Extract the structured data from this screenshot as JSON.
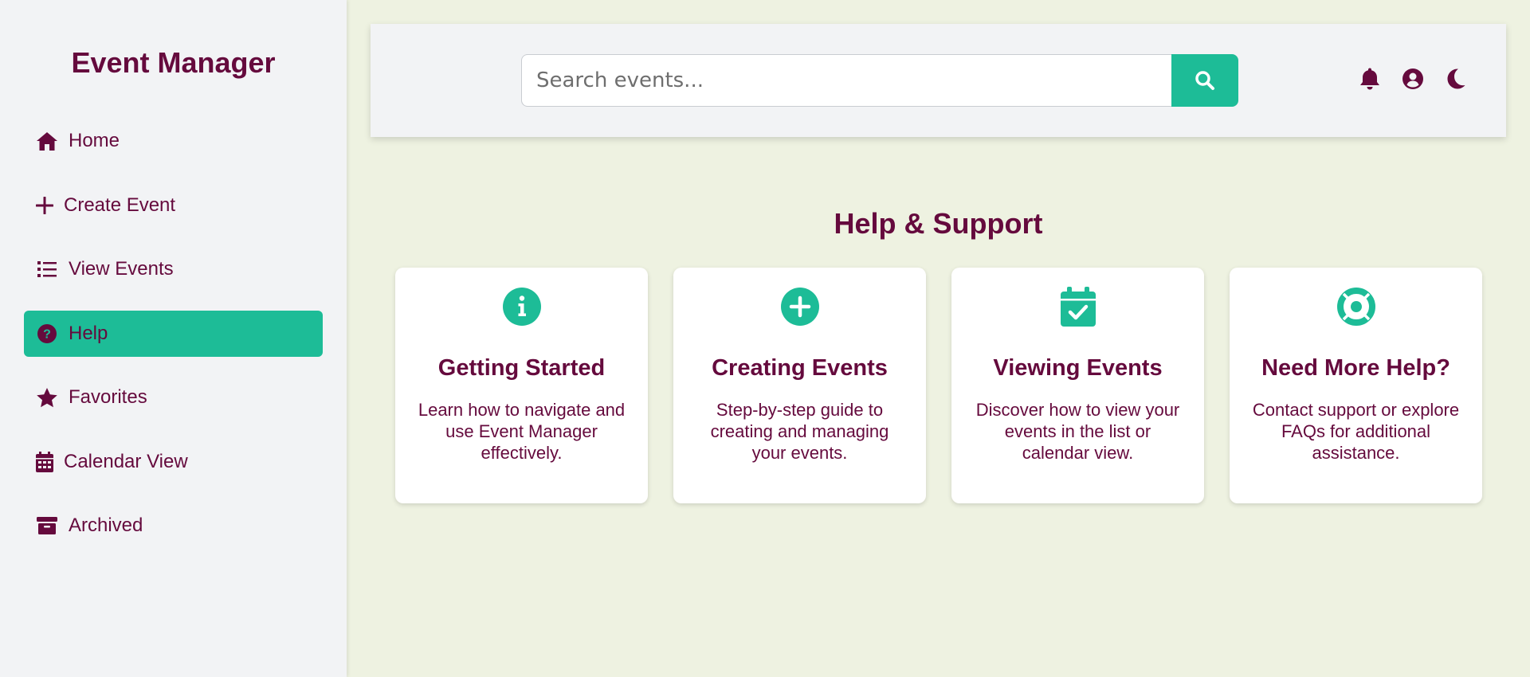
{
  "app": {
    "title": "Event Manager"
  },
  "sidebar": {
    "items": [
      {
        "label": "Home",
        "icon": "home-icon",
        "active": false
      },
      {
        "label": "Create Event",
        "icon": "plus-icon",
        "active": false
      },
      {
        "label": "View Events",
        "icon": "list-icon",
        "active": false
      },
      {
        "label": "Help",
        "icon": "question-circle-icon",
        "active": true
      },
      {
        "label": "Favorites",
        "icon": "star-icon",
        "active": false
      },
      {
        "label": "Calendar View",
        "icon": "calendar-icon",
        "active": false
      },
      {
        "label": "Archived",
        "icon": "archive-icon",
        "active": false
      }
    ]
  },
  "header": {
    "search": {
      "placeholder": "Search events...",
      "value": ""
    },
    "icons": [
      "search-icon",
      "bell-icon",
      "user-circle-icon",
      "moon-icon"
    ]
  },
  "main": {
    "title": "Help & Support",
    "cards": [
      {
        "icon": "info-circle-icon",
        "title": "Getting Started",
        "text": "Learn how to navigate and use Event Manager effectively."
      },
      {
        "icon": "plus-circle-icon",
        "title": "Creating Events",
        "text": "Step-by-step guide to creating and managing your events."
      },
      {
        "icon": "calendar-check-icon",
        "title": "Viewing Events",
        "text": "Discover how to view your events in the list or calendar view."
      },
      {
        "icon": "life-ring-icon",
        "title": "Need More Help?",
        "text": "Contact support or explore FAQs for additional assistance."
      }
    ]
  },
  "colors": {
    "accent": "#1dbc97",
    "brand": "#650a3d",
    "sidebar_bg": "#f2f3f5",
    "page_bg": "#eef2e1"
  }
}
